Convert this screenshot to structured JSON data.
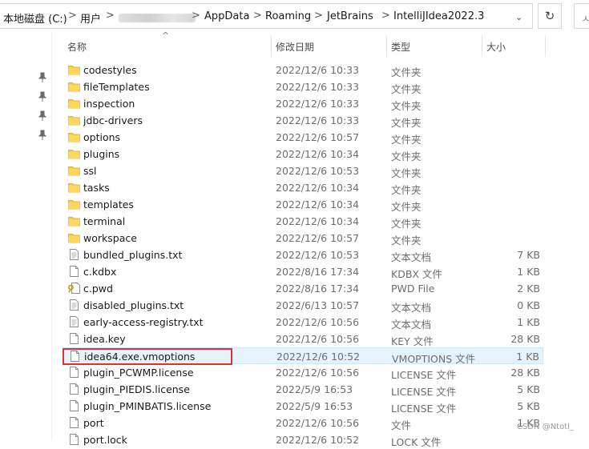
{
  "address_bar": {
    "drive": "本地磁盘 (C:)",
    "segments": [
      "用户",
      "AppData",
      "Roaming",
      "JetBrains",
      "IntelliJIdea2022.3"
    ],
    "separator": ">",
    "dropdown": "⌄"
  },
  "refresh_icon": "↻",
  "search_placeholder": "ㅅ",
  "columns": {
    "name": "名称",
    "date": "修改日期",
    "type": "类型",
    "size": "大小"
  },
  "rows": [
    {
      "name": "codestyles",
      "date": "2022/12/6 10:33",
      "type": "文件夹",
      "size": "",
      "icon": "folder-icon"
    },
    {
      "name": "fileTemplates",
      "date": "2022/12/6 10:33",
      "type": "文件夹",
      "size": "",
      "icon": "folder-icon"
    },
    {
      "name": "inspection",
      "date": "2022/12/6 10:33",
      "type": "文件夹",
      "size": "",
      "icon": "folder-icon"
    },
    {
      "name": "jdbc-drivers",
      "date": "2022/12/6 10:33",
      "type": "文件夹",
      "size": "",
      "icon": "folder-icon"
    },
    {
      "name": "options",
      "date": "2022/12/6 10:57",
      "type": "文件夹",
      "size": "",
      "icon": "folder-icon"
    },
    {
      "name": "plugins",
      "date": "2022/12/6 10:34",
      "type": "文件夹",
      "size": "",
      "icon": "folder-icon"
    },
    {
      "name": "ssl",
      "date": "2022/12/6 10:53",
      "type": "文件夹",
      "size": "",
      "icon": "folder-icon"
    },
    {
      "name": "tasks",
      "date": "2022/12/6 10:34",
      "type": "文件夹",
      "size": "",
      "icon": "folder-icon"
    },
    {
      "name": "templates",
      "date": "2022/12/6 10:34",
      "type": "文件夹",
      "size": "",
      "icon": "folder-icon"
    },
    {
      "name": "terminal",
      "date": "2022/12/6 10:34",
      "type": "文件夹",
      "size": "",
      "icon": "folder-icon"
    },
    {
      "name": "workspace",
      "date": "2022/12/6 10:57",
      "type": "文件夹",
      "size": "",
      "icon": "folder-icon"
    },
    {
      "name": "bundled_plugins.txt",
      "date": "2022/12/6 10:53",
      "type": "文本文档",
      "size": "7 KB",
      "icon": "text-file-icon"
    },
    {
      "name": "c.kdbx",
      "date": "2022/8/16 17:34",
      "type": "KDBX 文件",
      "size": "1 KB",
      "icon": "file-icon"
    },
    {
      "name": "c.pwd",
      "date": "2022/8/16 17:34",
      "type": "PWD File",
      "size": "2 KB",
      "icon": "key-file-icon"
    },
    {
      "name": "disabled_plugins.txt",
      "date": "2022/6/13 10:57",
      "type": "文本文档",
      "size": "0 KB",
      "icon": "text-file-icon"
    },
    {
      "name": "early-access-registry.txt",
      "date": "2022/12/6 10:56",
      "type": "文本文档",
      "size": "1 KB",
      "icon": "text-file-icon"
    },
    {
      "name": "idea.key",
      "date": "2022/12/6 10:56",
      "type": "KEY 文件",
      "size": "28 KB",
      "icon": "file-icon"
    },
    {
      "name": "idea64.exe.vmoptions",
      "date": "2022/12/6 10:52",
      "type": "VMOPTIONS 文件",
      "size": "1 KB",
      "icon": "file-icon",
      "selected": true
    },
    {
      "name": "plugin_PCWMP.license",
      "date": "2022/12/6 10:56",
      "type": "LICENSE 文件",
      "size": "28 KB",
      "icon": "file-icon"
    },
    {
      "name": "plugin_PIEDIS.license",
      "date": "2022/5/9 16:53",
      "type": "LICENSE 文件",
      "size": "5 KB",
      "icon": "file-icon"
    },
    {
      "name": "plugin_PMINBATIS.license",
      "date": "2022/5/9 16:53",
      "type": "LICENSE 文件",
      "size": "5 KB",
      "icon": "file-icon"
    },
    {
      "name": "port",
      "date": "2022/12/6 10:56",
      "type": "文件",
      "size": "1 KB",
      "icon": "file-icon"
    },
    {
      "name": "port.lock",
      "date": "2022/12/6 10:52",
      "type": "LOCK 文件",
      "size": "",
      "icon": "file-icon"
    }
  ],
  "watermark": "CSDN @Ntotl_",
  "colors": {
    "folder": "#f7c948",
    "selection": "#e5f3ff",
    "highlight_box": "#e03131"
  }
}
